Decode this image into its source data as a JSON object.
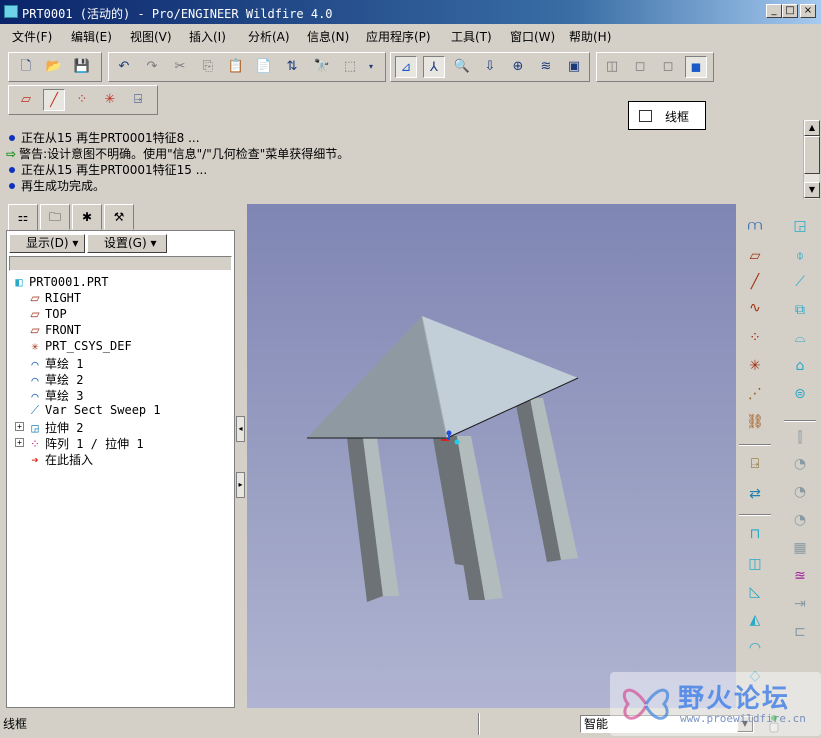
{
  "window": {
    "title": "PRT0001 (活动的) - Pro/ENGINEER Wildfire 4.0",
    "minimize": "_",
    "maximize": "□",
    "close": "×"
  },
  "menubar": [
    "文件(F)",
    "编辑(E)",
    "视图(V)",
    "插入(I)",
    "分析(A)",
    "信息(N)",
    "应用程序(P)",
    "工具(T)",
    "窗口(W)",
    "帮助(H)"
  ],
  "tooltip": {
    "label": "线框"
  },
  "messages": [
    {
      "type": "info",
      "text": "正在从15 再生PRT0001特征8 ..."
    },
    {
      "type": "warning",
      "text": "警告:设计意图不明确。使用\"信息\"/\"几何检查\"菜单获得细节。"
    },
    {
      "type": "info",
      "text": "正在从15 再生PRT0001特征15 ..."
    },
    {
      "type": "info",
      "text": "再生成功完成。"
    }
  ],
  "model_tree": {
    "show_button": "显示(D) ▾",
    "settings_button": "设置(G) ▾",
    "items": [
      {
        "label": "PRT0001.PRT",
        "icon": "part-icon"
      },
      {
        "label": "RIGHT",
        "icon": "datum-plane-icon"
      },
      {
        "label": "TOP",
        "icon": "datum-plane-icon"
      },
      {
        "label": "FRONT",
        "icon": "datum-plane-icon"
      },
      {
        "label": "PRT_CSYS_DEF",
        "icon": "csys-icon"
      },
      {
        "label": "草绘 1",
        "icon": "sketch-icon"
      },
      {
        "label": "草绘 2",
        "icon": "sketch-icon"
      },
      {
        "label": "草绘 3",
        "icon": "sketch-icon"
      },
      {
        "label": "Var Sect Sweep 1",
        "icon": "sweep-icon"
      },
      {
        "label": "拉伸 2",
        "icon": "extrude-icon"
      },
      {
        "label": "阵列 1 / 拉伸 1",
        "icon": "pattern-icon"
      },
      {
        "label": "在此插入",
        "icon": "insert-here-icon"
      }
    ]
  },
  "status": {
    "text": "线框",
    "filter": "智能"
  },
  "watermark": {
    "title": "野火论坛",
    "url": "www.proewildfire.cn"
  },
  "colors": {
    "title_bar": "#0a246a",
    "viewport_top": "#8086b4",
    "viewport_bottom": "#b0b4d2",
    "shell_dark": "#8e99a2",
    "shell_light": "#c3cfd8",
    "leg_dark": "#6c7275",
    "leg_light": "#b2bcbd"
  }
}
